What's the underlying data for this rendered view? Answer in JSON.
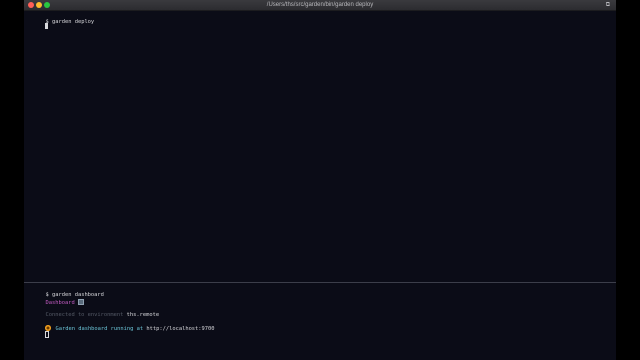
{
  "window": {
    "title": "/Users/ths/src/garden/bin/garden deploy",
    "right_icon": "⧉"
  },
  "top_pane": {
    "prompt_symbol": "$",
    "command": "garden deploy"
  },
  "bottom_pane": {
    "prompt_symbol": "$",
    "command": "garden dashboard",
    "dashboard_label": "Dashboard",
    "env_prefix": "Connected to environment",
    "env_name": "ths.remote",
    "running_text": "Garden dashboard running at",
    "url": "http://localhost:9700"
  },
  "colors": {
    "background": "#0b0c17",
    "dashboard_label": "#c35bc3",
    "running_text": "#6cc6d9",
    "dim_text": "#555a66"
  }
}
